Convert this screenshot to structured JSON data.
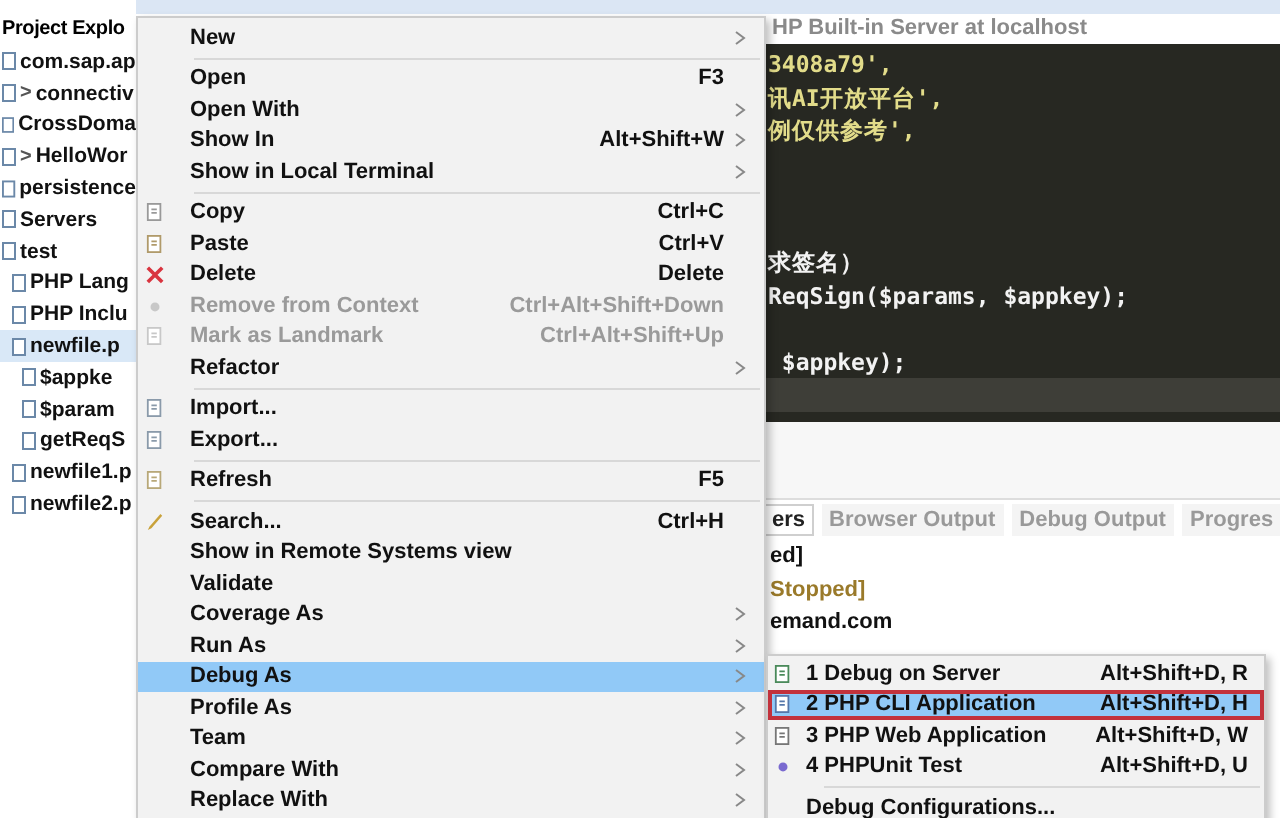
{
  "explorer": {
    "title": "Project Explo",
    "items": [
      {
        "label": "com.sap.ap",
        "selected": false
      },
      {
        "label": "connectiv",
        "expander": ">",
        "selected": false
      },
      {
        "label": "CrossDoma",
        "selected": false
      },
      {
        "label": "HelloWor",
        "expander": ">",
        "selected": false
      },
      {
        "label": "persistence",
        "selected": false
      },
      {
        "label": "Servers",
        "selected": false
      },
      {
        "label": "test",
        "selected": false,
        "children": [
          {
            "label": "PHP Lang",
            "selected": false
          },
          {
            "label": "PHP Inclu",
            "selected": false
          },
          {
            "label": "newfile.p",
            "selected": true,
            "children": [
              {
                "label": "$appke",
                "selected": false
              },
              {
                "label": "$param",
                "selected": false
              },
              {
                "label": "getReqS",
                "selected": false
              }
            ]
          },
          {
            "label": "newfile1.p",
            "selected": false
          },
          {
            "label": "newfile2.p",
            "selected": false
          }
        ]
      }
    ]
  },
  "editor": {
    "tab": "HP Built-in Server at localhost",
    "lines": [
      {
        "text": "3408a79',",
        "kind": "string"
      },
      {
        "text": "讯AI开放平台',",
        "kind": "string"
      },
      {
        "text": "例仅供参考',",
        "kind": "string"
      },
      {
        "kind": "blank"
      },
      {
        "kind": "blank"
      },
      {
        "kind": "blank"
      },
      {
        "text": "求签名）",
        "kind": "code"
      },
      {
        "text": "ReqSign($params, $appkey);",
        "kind": "code"
      },
      {
        "kind": "blank"
      },
      {
        "text": " $appkey);",
        "kind": "code"
      },
      {
        "kind": "current"
      }
    ]
  },
  "console": {
    "tabs": [
      {
        "label": "ers",
        "selected": true
      },
      {
        "label": "Browser Output",
        "selected": false
      },
      {
        "label": "Debug Output",
        "selected": false
      },
      {
        "label": "Progres",
        "selected": false
      }
    ],
    "lines": [
      {
        "text": "ed]",
        "kind": "plain"
      },
      {
        "text": "Stopped]",
        "kind": "status"
      },
      {
        "text": "emand.com",
        "kind": "plain"
      }
    ]
  },
  "context_menu": {
    "groups": [
      [
        {
          "label": "New",
          "submenu": true,
          "disabled": false,
          "selected": false
        }
      ],
      [
        {
          "label": "Open",
          "shortcut": "F3",
          "submenu": false,
          "disabled": false,
          "selected": false
        },
        {
          "label": "Open With",
          "submenu": true,
          "disabled": false,
          "selected": false
        },
        {
          "label": "Show In",
          "shortcut": "Alt+Shift+W",
          "submenu": true,
          "disabled": false,
          "selected": false
        },
        {
          "label": "Show in Local Terminal",
          "submenu": true,
          "disabled": false,
          "selected": false
        }
      ],
      [
        {
          "label": "Copy",
          "shortcut": "Ctrl+C",
          "submenu": false,
          "disabled": false,
          "selected": false
        },
        {
          "label": "Paste",
          "shortcut": "Ctrl+V",
          "submenu": false,
          "disabled": false,
          "selected": false
        },
        {
          "label": "Delete",
          "shortcut": "Delete",
          "submenu": false,
          "disabled": false,
          "selected": false
        },
        {
          "label": "Remove from Context",
          "shortcut": "Ctrl+Alt+Shift+Down",
          "submenu": false,
          "disabled": true,
          "selected": false
        },
        {
          "label": "Mark as Landmark",
          "shortcut": "Ctrl+Alt+Shift+Up",
          "submenu": false,
          "disabled": true,
          "selected": false
        },
        {
          "label": "Refactor",
          "submenu": true,
          "disabled": false,
          "selected": false
        }
      ],
      [
        {
          "label": "Import...",
          "submenu": false,
          "disabled": false,
          "selected": false
        },
        {
          "label": "Export...",
          "submenu": false,
          "disabled": false,
          "selected": false
        }
      ],
      [
        {
          "label": "Refresh",
          "shortcut": "F5",
          "submenu": false,
          "disabled": false,
          "selected": false
        }
      ],
      [
        {
          "label": "Search...",
          "shortcut": "Ctrl+H",
          "submenu": false,
          "disabled": false,
          "selected": false
        },
        {
          "label": "Show in Remote Systems view",
          "submenu": false,
          "disabled": false,
          "selected": false
        },
        {
          "label": "Validate",
          "submenu": false,
          "disabled": false,
          "selected": false
        },
        {
          "label": "Coverage As",
          "submenu": true,
          "disabled": false,
          "selected": false
        },
        {
          "label": "Run As",
          "submenu": true,
          "disabled": false,
          "selected": false
        },
        {
          "label": "Debug As",
          "submenu": true,
          "disabled": false,
          "selected": true
        },
        {
          "label": "Profile As",
          "submenu": true,
          "disabled": false,
          "selected": false
        },
        {
          "label": "Team",
          "submenu": true,
          "disabled": false,
          "selected": false
        },
        {
          "label": "Compare With",
          "submenu": true,
          "disabled": false,
          "selected": false
        },
        {
          "label": "Replace With",
          "submenu": true,
          "disabled": false,
          "selected": false
        }
      ]
    ]
  },
  "debug_submenu": {
    "groups": [
      [
        {
          "label": "1 Debug on Server",
          "shortcut": "Alt+Shift+D, R",
          "selected": false
        },
        {
          "label": "2 PHP CLI Application",
          "shortcut": "Alt+Shift+D, H",
          "selected": true
        },
        {
          "label": "3 PHP Web Application",
          "shortcut": "Alt+Shift+D, W",
          "selected": false
        },
        {
          "label": "4 PHPUnit Test",
          "shortcut": "Alt+Shift+D, U",
          "selected": false
        }
      ],
      [
        {
          "label": "Debug Configurations...",
          "selected": false
        }
      ]
    ]
  }
}
